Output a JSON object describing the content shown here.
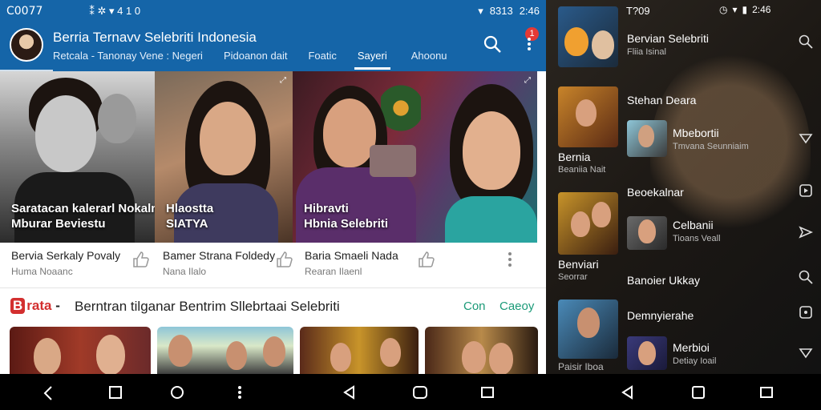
{
  "left": {
    "status": {
      "time": "C0077",
      "mid": "⁑ ✲ ▾ 4 1 0",
      "right_time": "2:46",
      "battery": "8313"
    },
    "appbar": {
      "title": "Berria Ternavv Selebriti Indonesia",
      "tabs": [
        "Retcala - Tanonay Vene : Negeri",
        "Pidoanon dait",
        "Foatic",
        "Sayeri",
        "Ahoonu"
      ],
      "active_tab_index": 3,
      "badge": "1"
    },
    "hero": [
      {
        "caption1": "Saratacan kalerarl Nokalnt -",
        "caption2": "Mburar Beviestu"
      },
      {
        "caption1": "Hlaostta",
        "caption2": "SIATYA"
      },
      {
        "caption1": "Hibravti",
        "caption2": "Hbnia Selebriti"
      }
    ],
    "meta": [
      {
        "title": "Bervia Serkaly Povaly",
        "sub": "Huma Noaanc"
      },
      {
        "title": "Bamer Strana Foldedy",
        "sub": "Nana Ilalo"
      },
      {
        "title": "Baria Smaeli Nada",
        "sub": "Rearan Ilaenl"
      }
    ],
    "section": {
      "brand": "rata",
      "brand_letter": "B",
      "title": "Berntran tilganar Bentrim Sllebrtaai Selebriti",
      "link1": "Con",
      "link2": "Caeoy"
    }
  },
  "right": {
    "status": {
      "time": "T?09",
      "clock": "2:46"
    },
    "items": [
      {
        "title": "Bervian Selebriti",
        "sub": "Fliia Isinal"
      },
      {
        "title": "Stehan Deara",
        "sub": ""
      },
      {
        "title": "Mbebortii",
        "sub": "Tmvana Seunniaim"
      },
      {
        "title": "Bernia",
        "sub": "Beaniia Nait"
      },
      {
        "title": "Beoekalnar",
        "sub": ""
      },
      {
        "title": "Celbanii",
        "sub": "Tioans Veall"
      },
      {
        "title": "Benviari",
        "sub": "Seorrar"
      },
      {
        "title": "Banoier Ukkay",
        "sub": ""
      },
      {
        "title": "Demnyierahe",
        "sub": ""
      },
      {
        "title": "Merbioi",
        "sub": "Detiay Ioail"
      },
      {
        "title": "Paisir Iboa",
        "sub": ""
      }
    ]
  },
  "colors": {
    "appbar": "#1565a8",
    "accent_link": "#1b9a78",
    "brand_red": "#d32f2f"
  }
}
